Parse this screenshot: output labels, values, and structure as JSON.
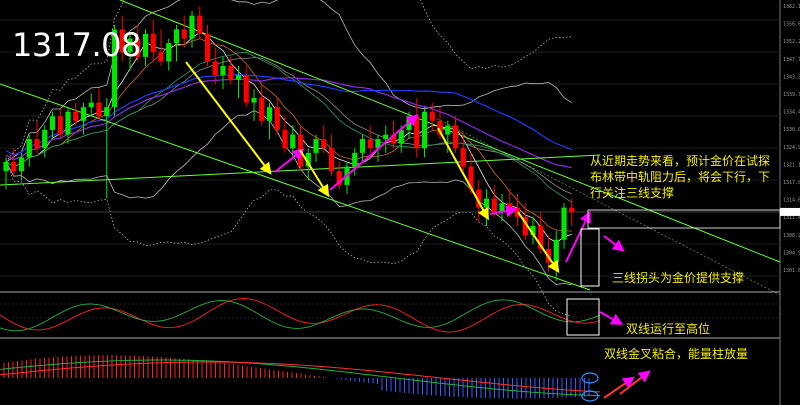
{
  "chart_data": {
    "type": "candlestick",
    "current_price": "1317.08",
    "price_axis_ticks": [
      "1362.10",
      "1356.65",
      "1352.20",
      "1347.75",
      "1343.30",
      "1339.70",
      "1334.45",
      "1330.00",
      "1324.90",
      "1321.10",
      "1317.08",
      "1314.60",
      "1311.40",
      "1308.20",
      "1304.90",
      "1301.60"
    ],
    "candles": [
      {
        "o": 1326,
        "h": 1329,
        "l": 1322,
        "c": 1328
      },
      {
        "o": 1328,
        "h": 1331,
        "l": 1325,
        "c": 1326
      },
      {
        "o": 1326,
        "h": 1330,
        "l": 1324,
        "c": 1329
      },
      {
        "o": 1329,
        "h": 1334,
        "l": 1327,
        "c": 1333
      },
      {
        "o": 1333,
        "h": 1337,
        "l": 1330,
        "c": 1331
      },
      {
        "o": 1331,
        "h": 1336,
        "l": 1329,
        "c": 1335
      },
      {
        "o": 1335,
        "h": 1339,
        "l": 1333,
        "c": 1338
      },
      {
        "o": 1338,
        "h": 1340,
        "l": 1333,
        "c": 1334
      },
      {
        "o": 1334,
        "h": 1340,
        "l": 1332,
        "c": 1339
      },
      {
        "o": 1339,
        "h": 1341,
        "l": 1336,
        "c": 1337
      },
      {
        "o": 1337,
        "h": 1341,
        "l": 1334,
        "c": 1340
      },
      {
        "o": 1340,
        "h": 1343,
        "l": 1338,
        "c": 1341
      },
      {
        "o": 1341,
        "h": 1344,
        "l": 1337,
        "c": 1338
      },
      {
        "o": 1338,
        "h": 1342,
        "l": 1320,
        "c": 1340
      },
      {
        "o": 1340,
        "h": 1358,
        "l": 1338,
        "c": 1357
      },
      {
        "o": 1357,
        "h": 1360,
        "l": 1350,
        "c": 1352
      },
      {
        "o": 1352,
        "h": 1356,
        "l": 1348,
        "c": 1355
      },
      {
        "o": 1355,
        "h": 1358,
        "l": 1350,
        "c": 1351
      },
      {
        "o": 1351,
        "h": 1357,
        "l": 1349,
        "c": 1356
      },
      {
        "o": 1356,
        "h": 1359,
        "l": 1350,
        "c": 1352
      },
      {
        "o": 1352,
        "h": 1357,
        "l": 1349,
        "c": 1350
      },
      {
        "o": 1350,
        "h": 1355,
        "l": 1348,
        "c": 1354
      },
      {
        "o": 1354,
        "h": 1358,
        "l": 1350,
        "c": 1357
      },
      {
        "o": 1357,
        "h": 1360,
        "l": 1353,
        "c": 1355
      },
      {
        "o": 1355,
        "h": 1361,
        "l": 1353,
        "c": 1360
      },
      {
        "o": 1360,
        "h": 1362,
        "l": 1355,
        "c": 1356
      },
      {
        "o": 1356,
        "h": 1358,
        "l": 1349,
        "c": 1350
      },
      {
        "o": 1350,
        "h": 1353,
        "l": 1345,
        "c": 1347
      },
      {
        "o": 1347,
        "h": 1351,
        "l": 1344,
        "c": 1349
      },
      {
        "o": 1349,
        "h": 1351,
        "l": 1345,
        "c": 1346
      },
      {
        "o": 1346,
        "h": 1349,
        "l": 1342,
        "c": 1347
      },
      {
        "o": 1347,
        "h": 1349,
        "l": 1340,
        "c": 1341
      },
      {
        "o": 1341,
        "h": 1344,
        "l": 1337,
        "c": 1342
      },
      {
        "o": 1342,
        "h": 1345,
        "l": 1336,
        "c": 1337
      },
      {
        "o": 1337,
        "h": 1341,
        "l": 1333,
        "c": 1340
      },
      {
        "o": 1340,
        "h": 1342,
        "l": 1334,
        "c": 1335
      },
      {
        "o": 1335,
        "h": 1338,
        "l": 1330,
        "c": 1331
      },
      {
        "o": 1331,
        "h": 1336,
        "l": 1329,
        "c": 1334
      },
      {
        "o": 1334,
        "h": 1336,
        "l": 1326,
        "c": 1327
      },
      {
        "o": 1327,
        "h": 1331,
        "l": 1324,
        "c": 1330
      },
      {
        "o": 1330,
        "h": 1334,
        "l": 1328,
        "c": 1333
      },
      {
        "o": 1333,
        "h": 1336,
        "l": 1330,
        "c": 1331
      },
      {
        "o": 1331,
        "h": 1334,
        "l": 1325,
        "c": 1326
      },
      {
        "o": 1326,
        "h": 1328,
        "l": 1322,
        "c": 1323
      },
      {
        "o": 1323,
        "h": 1328,
        "l": 1321,
        "c": 1327
      },
      {
        "o": 1327,
        "h": 1331,
        "l": 1325,
        "c": 1330
      },
      {
        "o": 1330,
        "h": 1334,
        "l": 1328,
        "c": 1333
      },
      {
        "o": 1333,
        "h": 1336,
        "l": 1330,
        "c": 1331
      },
      {
        "o": 1331,
        "h": 1334,
        "l": 1328,
        "c": 1333
      },
      {
        "o": 1333,
        "h": 1336,
        "l": 1330,
        "c": 1334
      },
      {
        "o": 1334,
        "h": 1337,
        "l": 1331,
        "c": 1332
      },
      {
        "o": 1332,
        "h": 1336,
        "l": 1330,
        "c": 1335
      },
      {
        "o": 1335,
        "h": 1339,
        "l": 1333,
        "c": 1338
      },
      {
        "o": 1338,
        "h": 1342,
        "l": 1329,
        "c": 1331
      },
      {
        "o": 1331,
        "h": 1340,
        "l": 1329,
        "c": 1339
      },
      {
        "o": 1339,
        "h": 1341,
        "l": 1335,
        "c": 1337
      },
      {
        "o": 1337,
        "h": 1340,
        "l": 1333,
        "c": 1334
      },
      {
        "o": 1334,
        "h": 1337,
        "l": 1330,
        "c": 1336
      },
      {
        "o": 1336,
        "h": 1338,
        "l": 1330,
        "c": 1331
      },
      {
        "o": 1331,
        "h": 1334,
        "l": 1326,
        "c": 1327
      },
      {
        "o": 1327,
        "h": 1330,
        "l": 1321,
        "c": 1322
      },
      {
        "o": 1322,
        "h": 1324,
        "l": 1315,
        "c": 1318
      },
      {
        "o": 1318,
        "h": 1322,
        "l": 1314,
        "c": 1320
      },
      {
        "o": 1320,
        "h": 1323,
        "l": 1316,
        "c": 1317
      },
      {
        "o": 1317,
        "h": 1321,
        "l": 1315,
        "c": 1319
      },
      {
        "o": 1319,
        "h": 1322,
        "l": 1316,
        "c": 1318
      },
      {
        "o": 1318,
        "h": 1321,
        "l": 1314,
        "c": 1316
      },
      {
        "o": 1316,
        "h": 1319,
        "l": 1311,
        "c": 1312
      },
      {
        "o": 1312,
        "h": 1316,
        "l": 1310,
        "c": 1314
      },
      {
        "o": 1314,
        "h": 1317,
        "l": 1308,
        "c": 1309
      },
      {
        "o": 1309,
        "h": 1312,
        "l": 1304,
        "c": 1306
      },
      {
        "o": 1306,
        "h": 1313,
        "l": 1302,
        "c": 1311
      },
      {
        "o": 1311,
        "h": 1319,
        "l": 1309,
        "c": 1318
      },
      {
        "o": 1318,
        "h": 1320,
        "l": 1314,
        "c": 1317
      }
    ]
  },
  "header": {
    "price_label": "1317.08"
  },
  "annotations": {
    "main_line_1": "从近期走势来看，预计金价在试探",
    "main_line_2": "布林带中轨阻力后，将会下行，下",
    "main_line_3": "行关注三线支撑",
    "support_note": "三线拐头为金价提供支撑",
    "osc_note": "双线运行至高位",
    "macd_note": "双线金叉粘合，能量柱放量"
  },
  "colors": {
    "bull": "#00e600",
    "bear": "#ff0000",
    "channel": "#66ff33",
    "yellow_arrow": "#ffff00",
    "magenta_arrow": "#ff00ff",
    "annotation_text": "#f5ef00"
  }
}
